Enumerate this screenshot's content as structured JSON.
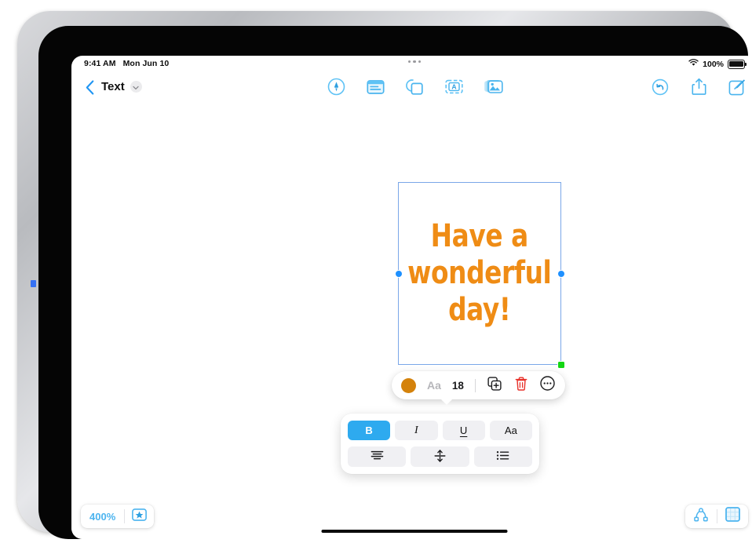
{
  "status_bar": {
    "time": "9:41 AM",
    "date": "Mon Jun 10",
    "battery_percent": "100%",
    "wifi_icon": "wifi-icon",
    "battery_icon": "battery-full-icon",
    "multitask_icon": "multitasking-dots-icon"
  },
  "nav_bar": {
    "back_icon": "chevron-left-icon",
    "title": "Text",
    "title_menu_icon": "chevron-down-icon",
    "center_tools": [
      {
        "name": "draw-tool",
        "icon": "pen-circle-icon"
      },
      {
        "name": "note-tool",
        "icon": "sticky-note-icon"
      },
      {
        "name": "shape-tool",
        "icon": "shapes-icon"
      },
      {
        "name": "text-tool",
        "icon": "text-box-icon"
      },
      {
        "name": "media-tool",
        "icon": "photos-icon"
      }
    ],
    "right_tools": [
      {
        "name": "undo-button",
        "icon": "undo-circle-icon"
      },
      {
        "name": "share-button",
        "icon": "share-up-icon"
      },
      {
        "name": "compose-button",
        "icon": "compose-pencil-icon"
      }
    ]
  },
  "canvas": {
    "text_box": {
      "content": "Have a\nwonderful\nday!",
      "color": "#ef8c15",
      "handles": [
        "left-handle",
        "right-handle",
        "corner-resize-handle"
      ]
    }
  },
  "context_toolbar": {
    "color_swatch": {
      "name": "color-swatch",
      "value": "#d4820b"
    },
    "font_label": "Aa",
    "font_size": "18",
    "duplicate_icon": "duplicate-icon",
    "delete_icon": "trash-icon",
    "more_icon": "more-ellipsis-icon"
  },
  "format_panel": {
    "row1": [
      {
        "name": "bold-button",
        "label": "B",
        "active": true
      },
      {
        "name": "italic-button",
        "label": "I",
        "active": false
      },
      {
        "name": "underline-button",
        "label": "U",
        "active": false
      },
      {
        "name": "font-style-button",
        "label": "Aa",
        "active": false
      }
    ],
    "row2": [
      {
        "name": "text-align-button",
        "icon": "align-center-icon"
      },
      {
        "name": "vertical-align-button",
        "icon": "vertical-align-middle-icon"
      },
      {
        "name": "list-button",
        "icon": "bullet-list-icon"
      }
    ],
    "accent_color": "#2eaaef"
  },
  "bottom_bar": {
    "zoom_level": "400%",
    "favorite_icon": "star-box-icon",
    "nodes_icon": "node-tree-icon",
    "page-grid_icon": "grid-page-icon"
  }
}
